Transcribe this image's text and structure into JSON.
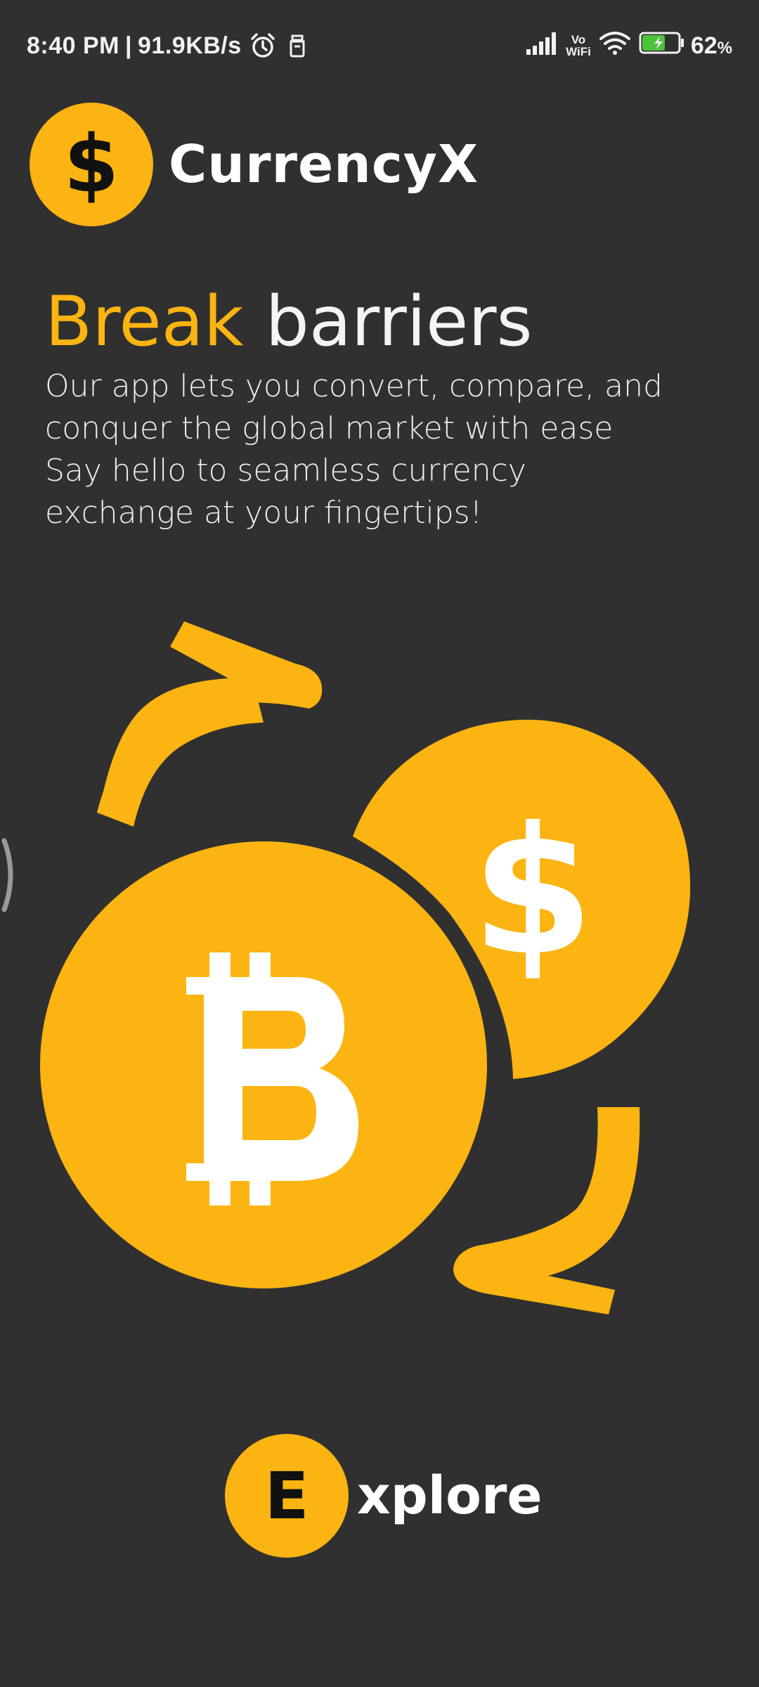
{
  "status_bar": {
    "time": "8:40 PM",
    "separator": "|",
    "speed": "91.9KB/s",
    "vowifi_top": "Vo",
    "vowifi_bottom": "WiFi",
    "battery_percent": "62",
    "percent_symbol": "%"
  },
  "brand": {
    "icon_symbol": "$",
    "name": "CurrencyX"
  },
  "hero": {
    "headline_accent": "Break",
    "headline_rest": "barriers",
    "description": [
      "Our app lets you convert, compare, and",
      "conquer the global market with ease",
      "Say hello to seamless currency",
      "exchange at your fingertips!"
    ]
  },
  "explore": {
    "letter": "E",
    "rest": "xplore"
  },
  "colors": {
    "background": "#303030",
    "accent": "#FBB411",
    "text": "#F4F4F4"
  },
  "icons": {
    "alarm": "alarm-clock-icon",
    "sim": "sim-notification-icon",
    "signal": "signal-bars-icon",
    "wifi": "wifi-icon",
    "battery": "battery-charging-icon",
    "bitcoin": "bitcoin-icon",
    "dollar": "dollar-coin-icon",
    "exchange_arrows": "exchange-arrows-icon"
  }
}
